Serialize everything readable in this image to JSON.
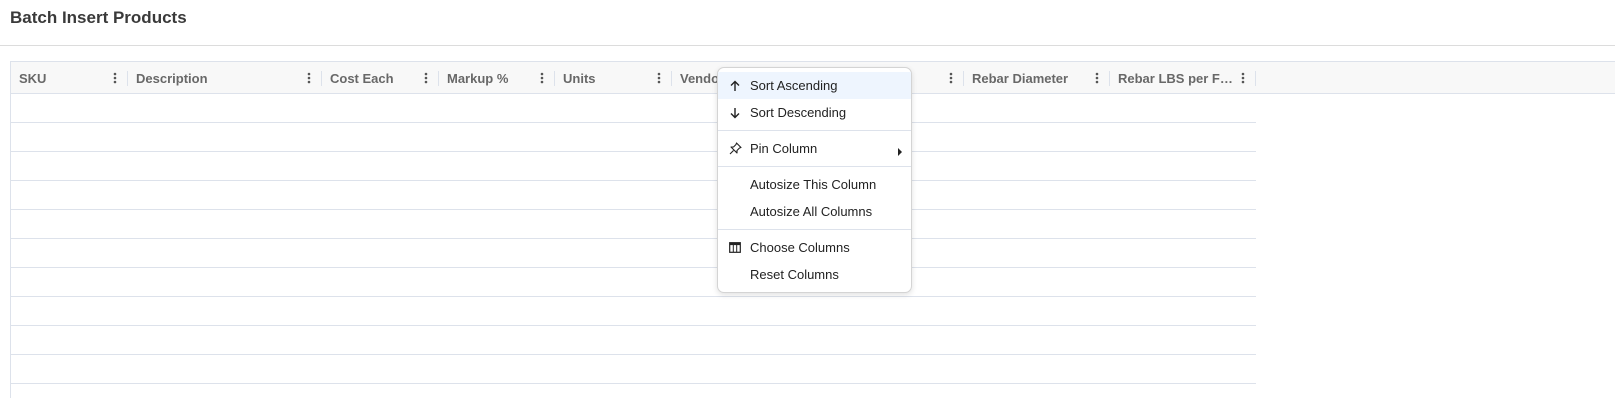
{
  "page": {
    "title": "Batch Insert Products"
  },
  "grid": {
    "columns": [
      {
        "label": "SKU"
      },
      {
        "label": "Description"
      },
      {
        "label": "Cost Each"
      },
      {
        "label": "Markup %"
      },
      {
        "label": "Units"
      },
      {
        "label": "Vendor"
      },
      {
        "label": ""
      },
      {
        "label": "Rebar Diameter"
      },
      {
        "label": "Rebar LBS per Foot"
      }
    ],
    "row_count": 10,
    "colors": {
      "header_bg": "#f8f8f8",
      "border": "#dde2eb",
      "header_text": "#686868"
    }
  },
  "column_menu": {
    "items": [
      {
        "label": "Sort Ascending",
        "icon": "arrow-up-icon",
        "active": true
      },
      {
        "label": "Sort Descending",
        "icon": "arrow-down-icon"
      },
      {
        "label": "Pin Column",
        "icon": "pin-icon",
        "submenu": true
      },
      {
        "label": "Autosize This Column"
      },
      {
        "label": "Autosize All Columns"
      },
      {
        "label": "Choose Columns",
        "icon": "columns-icon"
      },
      {
        "label": "Reset Columns"
      }
    ],
    "active_bg": "#eef5fe"
  }
}
